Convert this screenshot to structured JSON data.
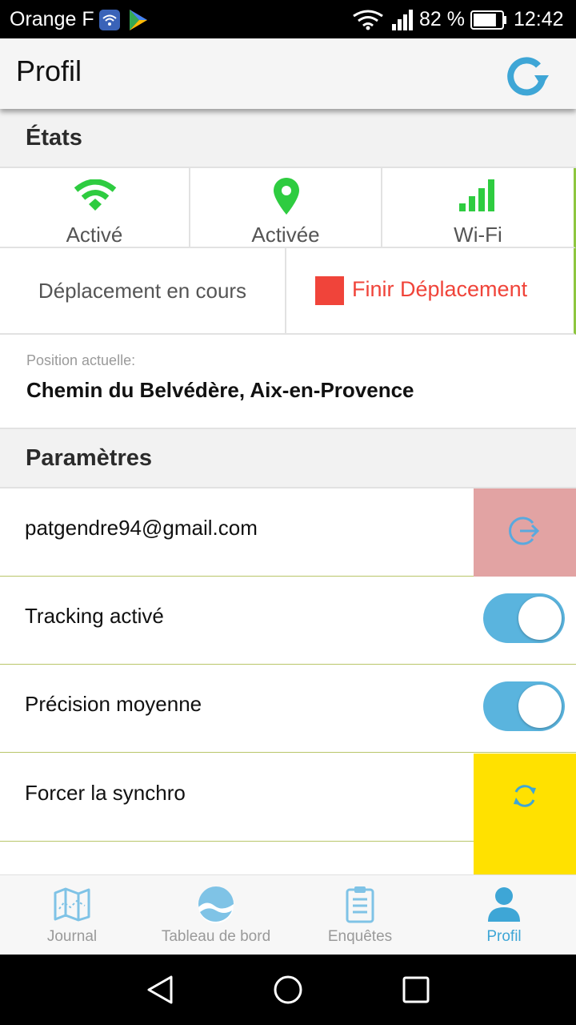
{
  "status_bar": {
    "carrier": "Orange F",
    "battery_percent": "82 %",
    "time": "12:42",
    "battery_level": 0.82,
    "icons": [
      "wifi-icon",
      "play-store-icon",
      "signal-icon",
      "battery-icon"
    ]
  },
  "header": {
    "title": "Profil",
    "refresh_icon": "refresh-icon"
  },
  "states_section": {
    "title": "États",
    "items": [
      {
        "label": "Activé",
        "icon": "wifi-icon"
      },
      {
        "label": "Activée",
        "icon": "location-pin-icon"
      },
      {
        "label": "Wi-Fi",
        "icon": "signal-bars-icon"
      }
    ],
    "trip_status": "Déplacement en cours",
    "finish_trip_label": "Finir Déplacement",
    "position_label": "Position actuelle:",
    "position_value": "Chemin du Belvédère, Aix-en-Provence"
  },
  "settings_section": {
    "title": "Paramètres",
    "account_email": "patgendre94@gmail.com",
    "tracking_label": "Tracking activé",
    "tracking_on": true,
    "precision_label": "Précision moyenne",
    "precision_on": true,
    "force_sync_label": "Forcer la synchro"
  },
  "tab_bar": {
    "tabs": [
      {
        "label": "Journal",
        "icon": "map-icon",
        "active": false
      },
      {
        "label": "Tableau de bord",
        "icon": "dashboard-icon",
        "active": false
      },
      {
        "label": "Enquêtes",
        "icon": "clipboard-icon",
        "active": false
      },
      {
        "label": "Profil",
        "icon": "user-icon",
        "active": true
      }
    ]
  },
  "colors": {
    "accent_blue": "#3ea6d6",
    "green": "#2ecc40",
    "red": "#f0443a",
    "logout_bg": "#e2a3a3",
    "sync_bg": "#ffe100"
  }
}
